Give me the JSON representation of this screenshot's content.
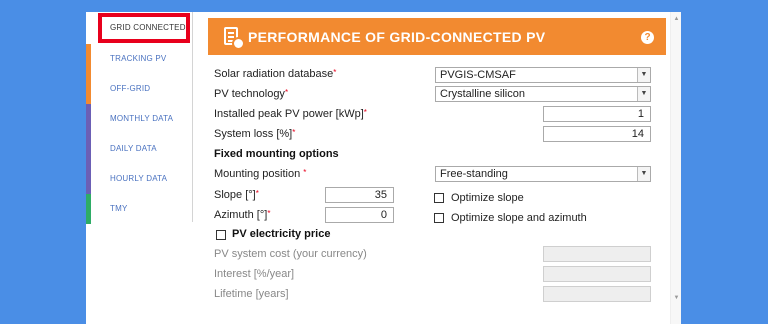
{
  "sidebar": {
    "tabs": [
      {
        "label": "GRID CONNECTED",
        "color": "#ffffff"
      },
      {
        "label": "TRACKING PV",
        "color": "#f28a30"
      },
      {
        "label": "OFF-GRID",
        "color": "#f28a30"
      },
      {
        "label": "MONTHLY DATA",
        "color": "#6b5fb5"
      },
      {
        "label": "DAILY DATA",
        "color": "#6b5fb5"
      },
      {
        "label": "HOURLY DATA",
        "color": "#6b5fb5"
      },
      {
        "label": "TMY",
        "color": "#2eac66"
      }
    ]
  },
  "header": {
    "title": "PERFORMANCE OF GRID-CONNECTED PV",
    "help": "?"
  },
  "form": {
    "radiation_db": {
      "label": "Solar radiation database",
      "required": "*",
      "value": "PVGIS-CMSAF"
    },
    "pv_tech": {
      "label": "PV technology",
      "required": "*",
      "value": "Crystalline silicon"
    },
    "peak_power": {
      "label": "Installed peak PV power [kWp]",
      "required": "*",
      "value": "1"
    },
    "system_loss": {
      "label": "System loss [%]",
      "required": "*",
      "value": "14"
    },
    "fixed_section": "Fixed mounting options",
    "mounting_position": {
      "label": "Mounting position",
      "required": "*",
      "value": "Free-standing"
    },
    "slope": {
      "label": "Slope [°]",
      "required": "*",
      "value": "35"
    },
    "azimuth": {
      "label": "Azimuth [°]",
      "required": "*",
      "value": "0"
    },
    "optimize_slope": "Optimize slope",
    "optimize_slope_azimuth": "Optimize slope and azimuth",
    "electricity_price": "PV electricity price",
    "system_cost": {
      "label": "PV system cost (your currency)",
      "value": ""
    },
    "interest": {
      "label": "Interest [%/year]",
      "value": ""
    },
    "lifetime": {
      "label": "Lifetime [years]",
      "value": ""
    }
  }
}
